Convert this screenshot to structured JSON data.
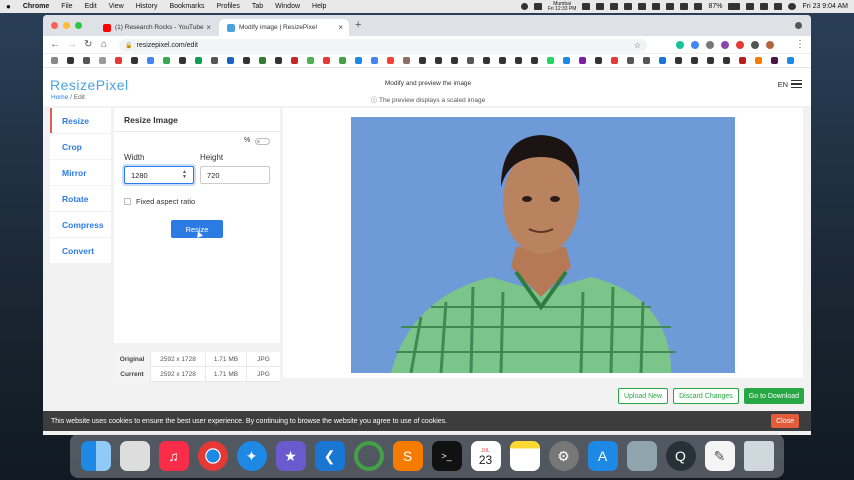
{
  "menubar": {
    "apple": "",
    "app": "Chrome",
    "items": [
      "File",
      "Edit",
      "View",
      "History",
      "Bookmarks",
      "Profiles",
      "Tab",
      "Window",
      "Help"
    ],
    "clock_city": "Mumbai",
    "clock_time": "Fri 12:33 PM",
    "battery": "87%",
    "datetime": "Fri 23 9:04 AM"
  },
  "browser": {
    "tabs": [
      {
        "title": "(1) Research Rocks - YouTube",
        "active": false
      },
      {
        "title": "Modify image | ResizePixel",
        "active": true
      }
    ],
    "close_glyph": "×",
    "new_tab_glyph": "+",
    "url": "resizepixel.com/edit"
  },
  "app": {
    "logo": "ResizePixel",
    "breadcrumb_home": "Home",
    "breadcrumb_sep": " / ",
    "breadcrumb_current": "Edit",
    "header_title": "Modify and preview the image",
    "header_sub": "ⓘ The preview displays a scaled image",
    "lang": "EN",
    "sidebar": [
      "Resize",
      "Crop",
      "Mirror",
      "Rotate",
      "Compress",
      "Convert"
    ],
    "panel": {
      "title": "Resize Image",
      "percent_label": "%",
      "width_label": "Width",
      "width_value": "1280",
      "height_label": "Height",
      "height_value": "720",
      "aspect_label": "Fixed aspect ratio",
      "button": "Resize"
    },
    "info": [
      {
        "label": "Original",
        "dims": "2592 x 1728",
        "size": "1.71 MB",
        "type": "JPG"
      },
      {
        "label": "Current",
        "dims": "2592 x 1728",
        "size": "1.71 MB",
        "type": "JPG"
      }
    ],
    "actions": {
      "upload": "Upload New",
      "discard": "Discard Changes",
      "download": "Go to Download"
    }
  },
  "cookie": {
    "text": "This website uses cookies to ensure the best user experience. By continuing to browse the website you agree to use of cookies.",
    "close": "Close"
  },
  "dock": {
    "calendar_month": "JUL",
    "calendar_day": "23"
  }
}
